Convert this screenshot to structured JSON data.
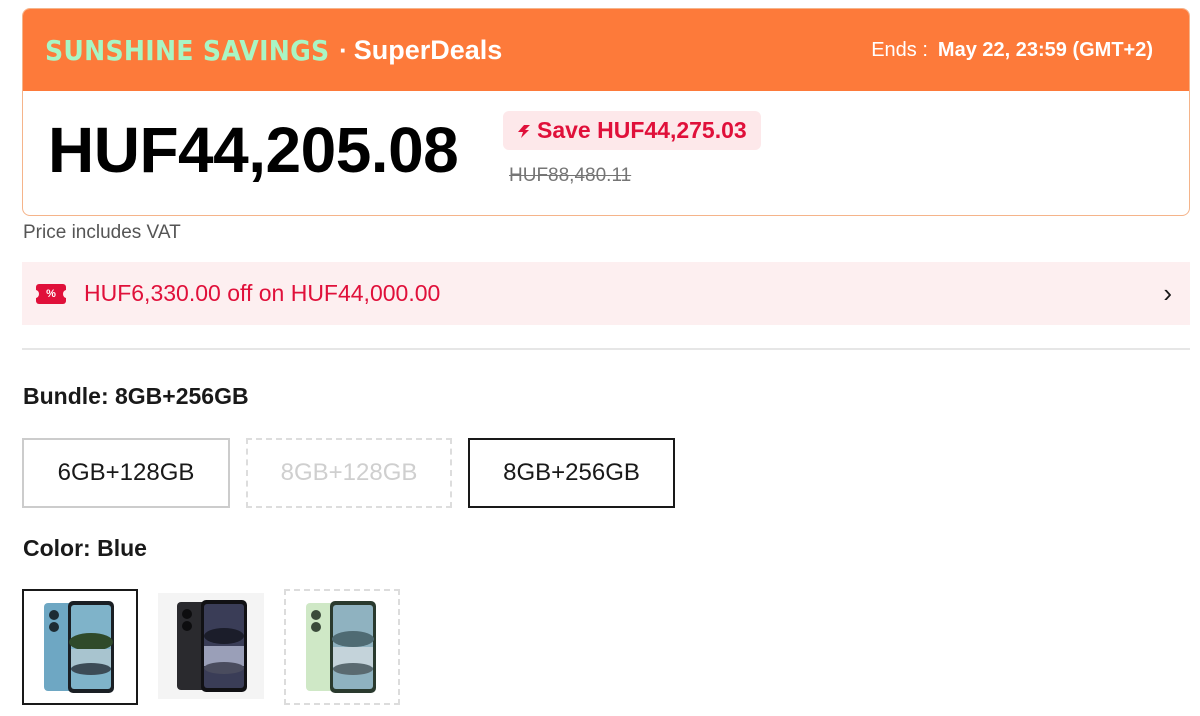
{
  "deal": {
    "campaign": "SUNSHINE SAVINGS",
    "separator": "·",
    "program": "SuperDeals",
    "ends_label": "Ends :",
    "ends_value": "May 22, 23:59 (GMT+2)",
    "price": "HUF44,205.08",
    "save_text": "Save HUF44,275.03",
    "original_price": "HUF88,480.11",
    "colors": {
      "header": "#fd7a3a",
      "campaign": "#a9f5c4",
      "save": "#e0103a"
    }
  },
  "vat_note": "Price includes VAT",
  "coupon": {
    "icon": "coupon-percent-icon",
    "icon_text": "%",
    "text": "HUF6,330.00 off on HUF44,000.00",
    "chevron": "›"
  },
  "bundle": {
    "label": "Bundle: 8GB+256GB",
    "options": [
      {
        "label": "6GB+128GB",
        "state": "available"
      },
      {
        "label": "8GB+128GB",
        "state": "unavailable"
      },
      {
        "label": "8GB+256GB",
        "state": "selected"
      }
    ]
  },
  "color": {
    "label": "Color: Blue",
    "options": [
      {
        "name": "blue-phone-thumbnail",
        "state": "selected",
        "body": "#6ea7c3"
      },
      {
        "name": "black-phone-thumbnail",
        "state": "available",
        "body": "#2a2a2e"
      },
      {
        "name": "green-phone-thumbnail",
        "state": "unavailable",
        "body": "#cfe8c6"
      }
    ]
  }
}
